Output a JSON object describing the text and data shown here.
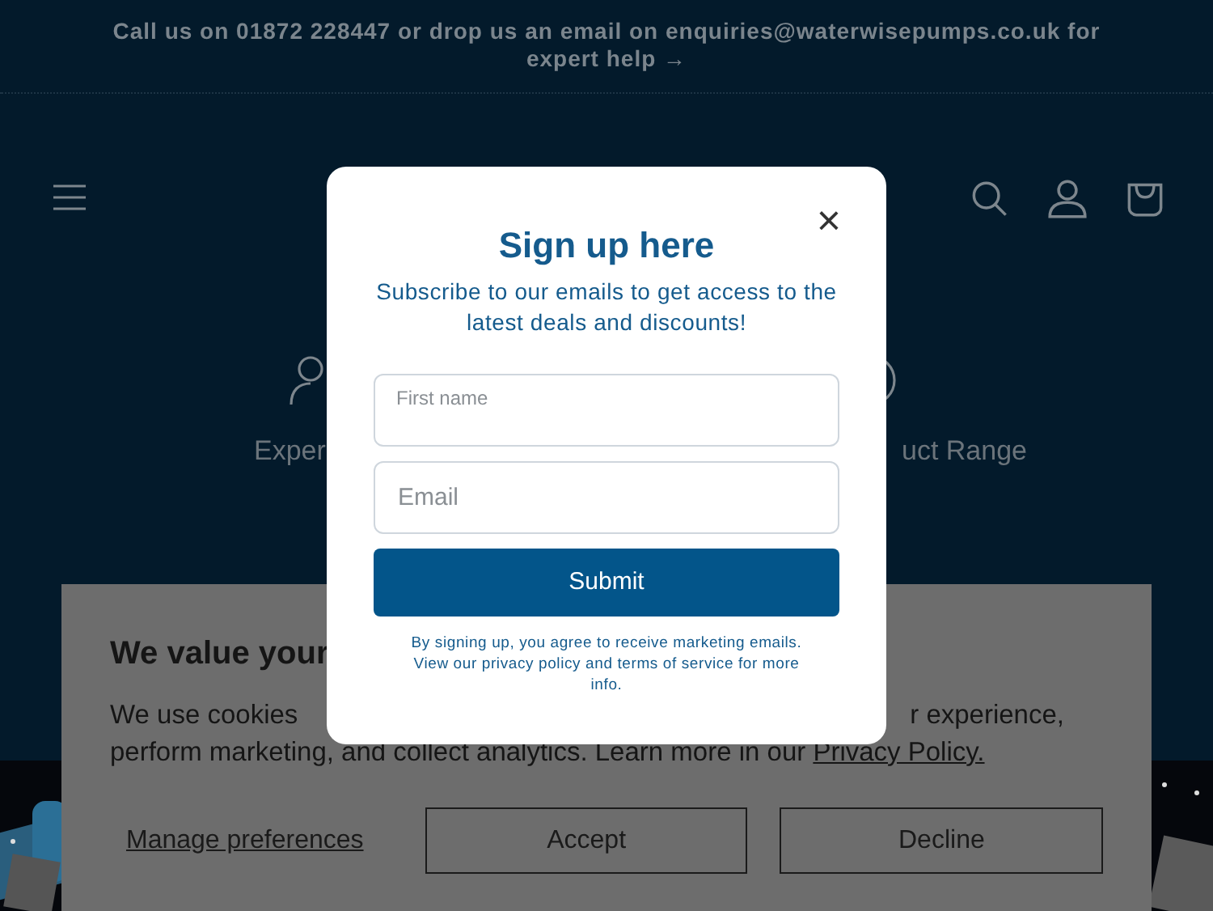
{
  "announcement": {
    "text": "Call us on 01872 228447 or drop us an email on enquiries@waterwisepumps.co.uk for expert help",
    "arrow": "→"
  },
  "features": [
    {
      "text": "Exper"
    },
    {
      "text": "uct Range"
    }
  ],
  "cookie_banner": {
    "title": "We value your",
    "body_start": "We use cookies",
    "body_end": "r experience,",
    "body_line_2": "perform marketing, and collect analytics. Learn more in our",
    "link": "Privacy Policy.",
    "buttons": [
      {
        "label": "Manage preferences",
        "kind": "link"
      },
      {
        "label": "Accept",
        "kind": "outline"
      },
      {
        "label": "Decline",
        "kind": "outline"
      }
    ]
  },
  "modal": {
    "close": "×",
    "title": "Sign up here",
    "subtitle": "Subscribe to our emails to get access to the latest deals and discounts!",
    "fields": [
      {
        "placeholder": "First name",
        "kind": "floating"
      },
      {
        "placeholder": "Email",
        "kind": "plain"
      }
    ],
    "submit": "Submit",
    "disclaimer": "By signing up, you agree to receive marketing emails. View our privacy policy and terms of service for more info."
  }
}
